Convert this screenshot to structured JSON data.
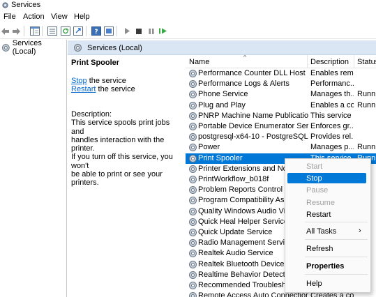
{
  "window": {
    "title": "Services"
  },
  "menu": [
    "File",
    "Action",
    "View",
    "Help"
  ],
  "tree": {
    "root": "Services (Local)"
  },
  "main_header": "Services (Local)",
  "ext_panel": {
    "service_name": "Print Spooler",
    "stop_link": "Stop",
    "stop_suffix": " the service",
    "restart_link": "Restart",
    "restart_suffix": " the service",
    "desc_label": "Description:",
    "desc_lines": [
      "This service spools print jobs and",
      "handles interaction with the printer.",
      "If you turn off this service, you won't",
      "be able to print or see your printers."
    ]
  },
  "columns": {
    "name": "Name",
    "description": "Description",
    "status": "Status"
  },
  "services": [
    {
      "name": "Performance Counter DLL Host",
      "desc": "Enables rem...",
      "status": ""
    },
    {
      "name": "Performance Logs & Alerts",
      "desc": "Performanc...",
      "status": ""
    },
    {
      "name": "Phone Service",
      "desc": "Manages th...",
      "status": "Runni"
    },
    {
      "name": "Plug and Play",
      "desc": "Enables a co...",
      "status": "Runni"
    },
    {
      "name": "PNRP Machine Name Publication ...",
      "desc": "This service ...",
      "status": ""
    },
    {
      "name": "Portable Device Enumerator Service",
      "desc": "Enforces gr...",
      "status": ""
    },
    {
      "name": "postgresql-x64-10 - PostgreSQL Se...",
      "desc": "Provides rel...",
      "status": ""
    },
    {
      "name": "Power",
      "desc": "Manages p...",
      "status": "Runni"
    },
    {
      "name": "Print Spooler",
      "desc": "This service ...",
      "status": "Runni",
      "selected": true
    },
    {
      "name": "Printer Extensions and Notific",
      "desc": "",
      "status": ""
    },
    {
      "name": "PrintWorkflow_b018f",
      "desc": "",
      "status": ""
    },
    {
      "name": "Problem Reports Control Pane",
      "desc": "",
      "status": ""
    },
    {
      "name": "Program Compatibility Assista",
      "desc": "",
      "status": ""
    },
    {
      "name": "Quality Windows Audio Video",
      "desc": "",
      "status": ""
    },
    {
      "name": "Quick Heal Helper Service WS",
      "desc": "",
      "status": ""
    },
    {
      "name": "Quick Update Service",
      "desc": "",
      "status": ""
    },
    {
      "name": "Radio Management Service",
      "desc": "",
      "status": ""
    },
    {
      "name": "Realtek Audio Service",
      "desc": "",
      "status": ""
    },
    {
      "name": "Realtek Bluetooth Device Man",
      "desc": "",
      "status": ""
    },
    {
      "name": "Realtime Behavior Detection",
      "desc": "",
      "status": ""
    },
    {
      "name": "Recommended Troubleshootin",
      "desc": "",
      "status": ""
    },
    {
      "name": "Remote Access Auto Connection ...",
      "desc": "Creates a co...",
      "status": ""
    }
  ],
  "context_menu": {
    "start": "Start",
    "stop": "Stop",
    "pause": "Pause",
    "resume": "Resume",
    "restart": "Restart",
    "all_tasks": "All Tasks",
    "all_tasks_arrow": "›",
    "refresh": "Refresh",
    "properties": "Properties",
    "help": "Help"
  },
  "colors": {
    "accent": "#0078d7",
    "header_bg": "#dbe6f4",
    "link": "#0066cc",
    "disabled": "#a0a0a0"
  },
  "icons": {
    "app": "services-gear-icon",
    "toolbar": [
      "back-arrow-icon",
      "forward-arrow-icon",
      "up-level-icon",
      "show-hide-tree-icon",
      "export-list-icon",
      "refresh-icon",
      "properties-icon",
      "help-book-icon",
      "play-icon",
      "stop-icon",
      "pause-icon",
      "restart-icon"
    ],
    "service": "gear-icon"
  }
}
